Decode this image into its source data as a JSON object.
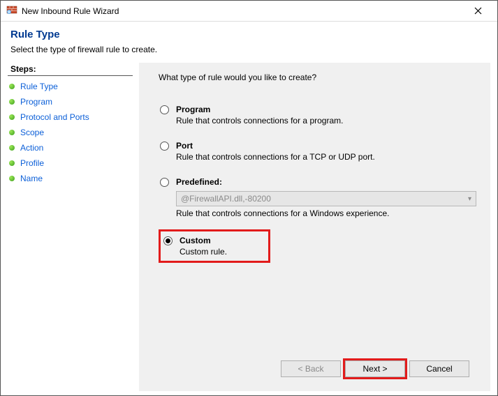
{
  "window": {
    "title": "New Inbound Rule Wizard"
  },
  "header": {
    "title": "Rule Type",
    "subtitle": "Select the type of firewall rule to create."
  },
  "steps": {
    "title": "Steps:",
    "items": [
      {
        "label": "Rule Type"
      },
      {
        "label": "Program"
      },
      {
        "label": "Protocol and Ports"
      },
      {
        "label": "Scope"
      },
      {
        "label": "Action"
      },
      {
        "label": "Profile"
      },
      {
        "label": "Name"
      }
    ]
  },
  "main": {
    "question": "What type of rule would you like to create?",
    "options": {
      "program": {
        "label": "Program",
        "desc": "Rule that controls connections for a program."
      },
      "port": {
        "label": "Port",
        "desc": "Rule that controls connections for a TCP or UDP port."
      },
      "predefined": {
        "label": "Predefined:",
        "select_value": "@FirewallAPI.dll,-80200",
        "desc": "Rule that controls connections for a Windows experience."
      },
      "custom": {
        "label": "Custom",
        "desc": "Custom rule."
      }
    }
  },
  "footer": {
    "back": "< Back",
    "next": "Next >",
    "cancel": "Cancel"
  }
}
